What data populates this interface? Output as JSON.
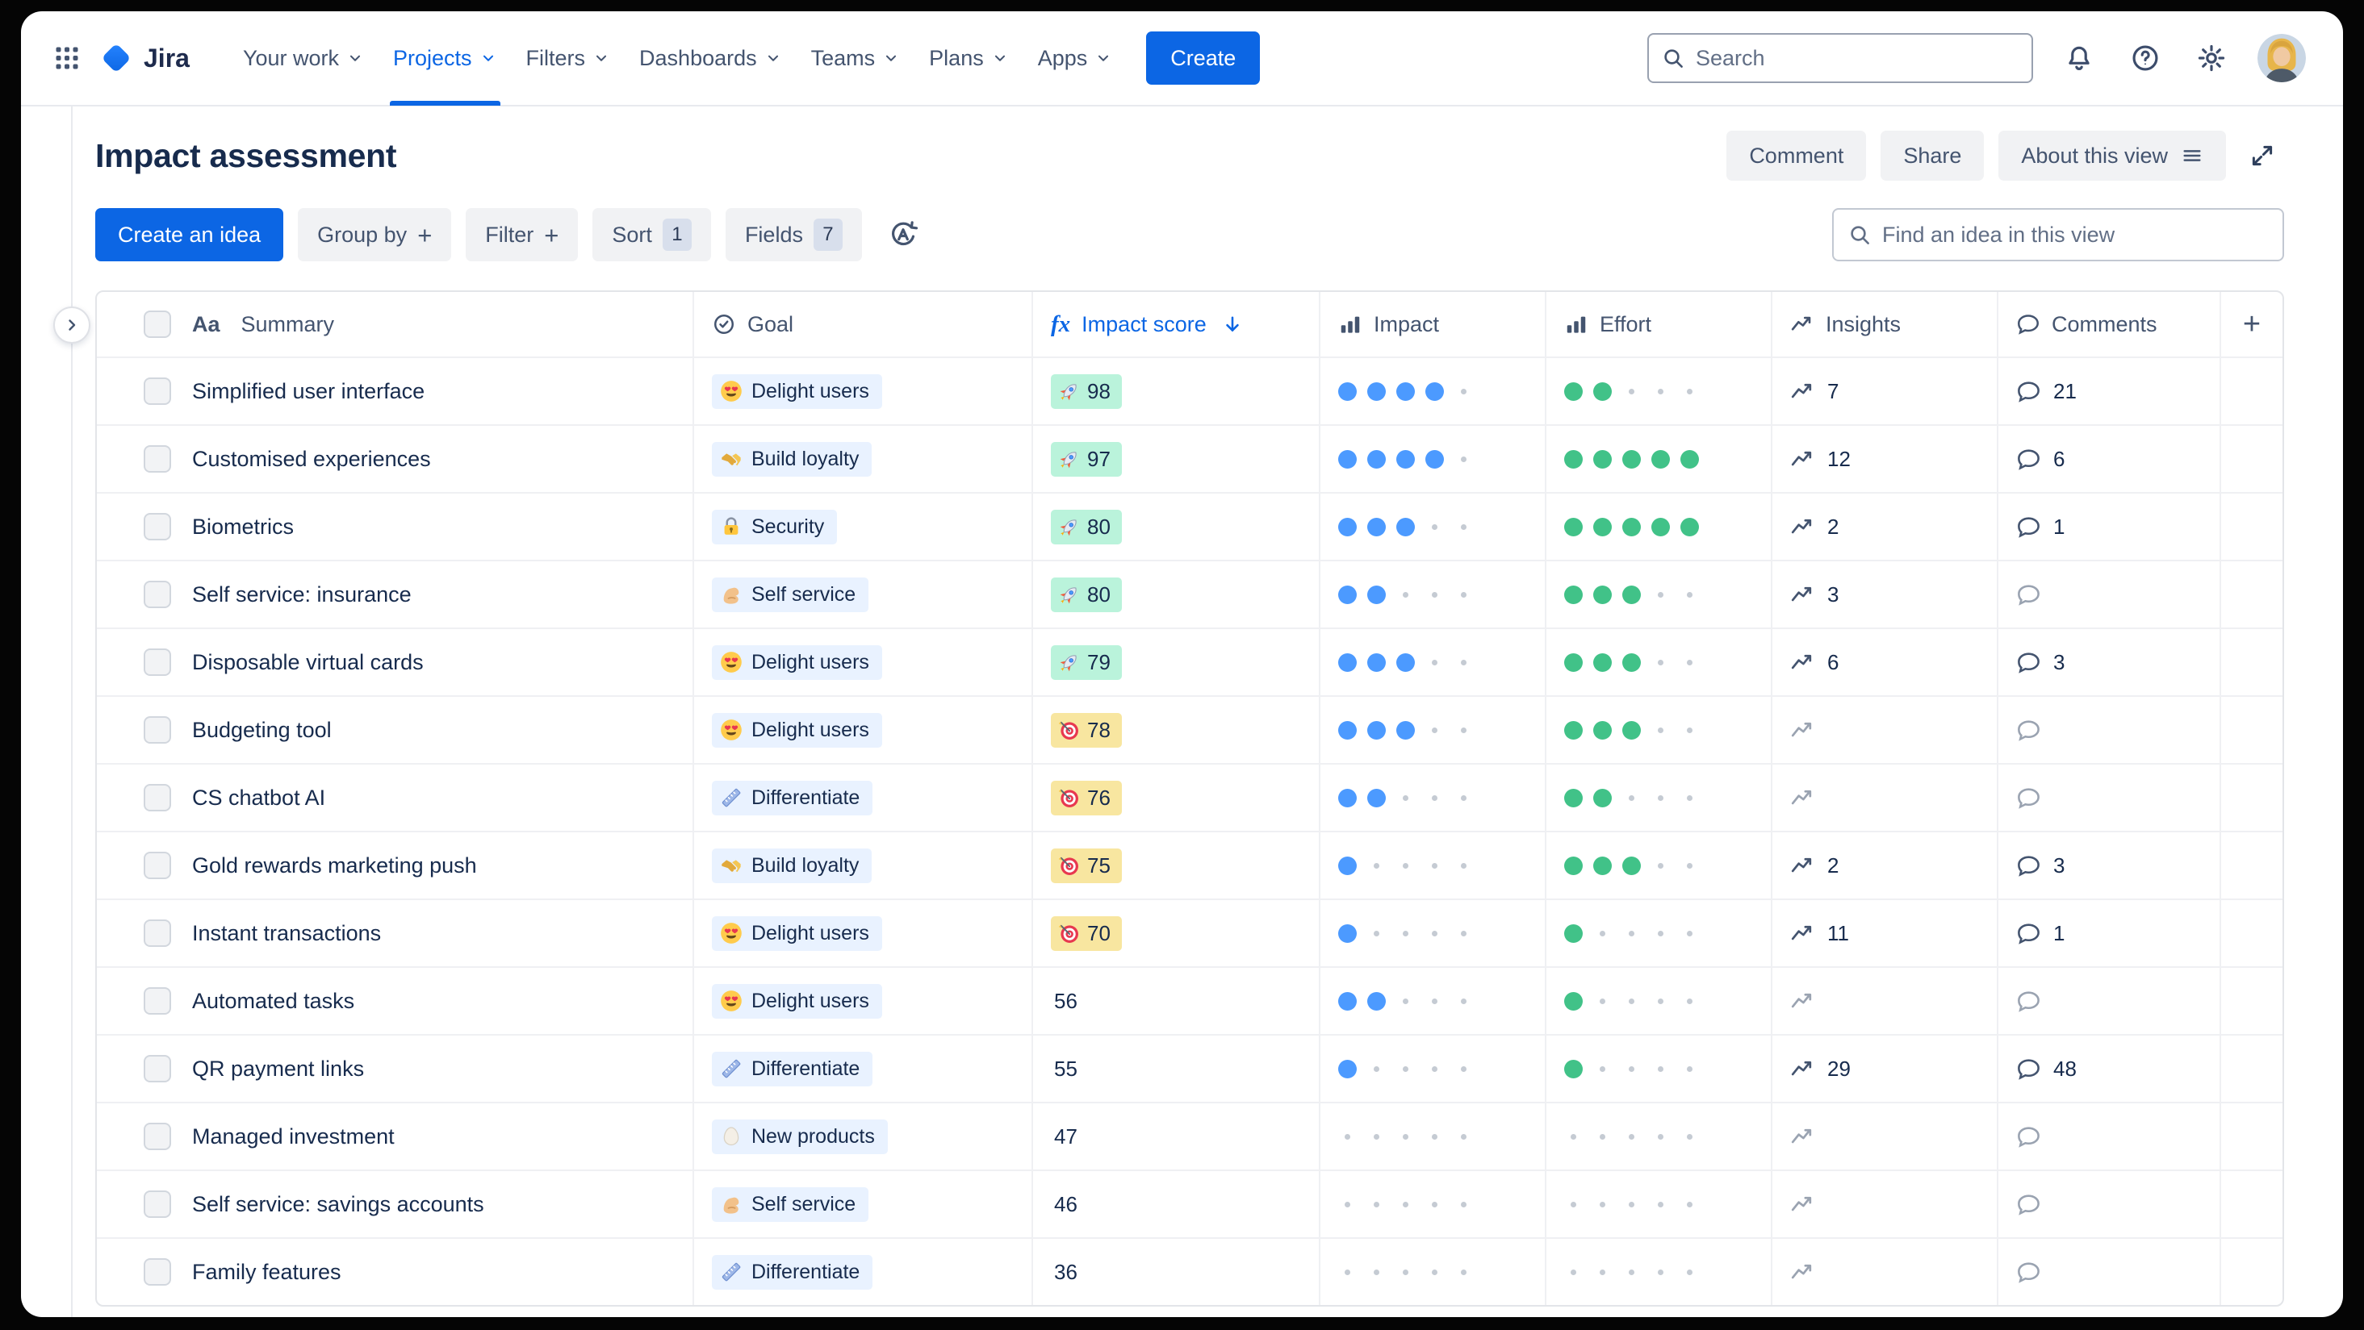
{
  "colors": {
    "accent_blue": "#0C66E4",
    "goal_badge_bg": "#E9F2FF",
    "score_green_bg": "#BAF3DB",
    "score_yellow_bg": "#F8E6A0",
    "impact_dot": "#4C9AFF",
    "effort_dot": "#41C288"
  },
  "nav": {
    "logo_text": "Jira",
    "items": [
      {
        "label": "Your work"
      },
      {
        "label": "Projects",
        "active": true
      },
      {
        "label": "Filters"
      },
      {
        "label": "Dashboards"
      },
      {
        "label": "Teams"
      },
      {
        "label": "Plans"
      },
      {
        "label": "Apps"
      }
    ],
    "create_label": "Create",
    "search_placeholder": "Search",
    "right_icons": [
      "notifications-icon",
      "help-icon",
      "settings-icon",
      "user-avatar"
    ]
  },
  "header": {
    "title": "Impact assessment",
    "comment_label": "Comment",
    "share_label": "Share",
    "about_label": "About this view"
  },
  "toolbar": {
    "create_idea_label": "Create an idea",
    "chips": [
      {
        "label": "Group by",
        "suffix": "+"
      },
      {
        "label": "Filter",
        "suffix": "+"
      },
      {
        "label": "Sort",
        "count": "1"
      },
      {
        "label": "Fields",
        "count": "7"
      }
    ],
    "auto_sort_icon": "auto-sort-icon",
    "find_placeholder": "Find an idea in this view"
  },
  "table": {
    "summary_type_glyph": "Aa",
    "formula_glyph": "fx",
    "columns": {
      "summary": "Summary",
      "goal": "Goal",
      "impact_score": "Impact score",
      "impact": "Impact",
      "effort": "Effort",
      "insights": "Insights",
      "comments": "Comments",
      "add_column": "+"
    },
    "sort": {
      "column": "Impact score",
      "direction": "desc"
    },
    "rating_max": 5,
    "rows": [
      {
        "summary": "Simplified user interface",
        "goal": {
          "icon": "heart-eyes-emoji",
          "label": "Delight users"
        },
        "score": {
          "value": 98,
          "tier": "green",
          "icon": "rocket-emoji"
        },
        "impact": 4,
        "effort": 2,
        "insights": 7,
        "comments": 21
      },
      {
        "summary": "Customised experiences",
        "goal": {
          "icon": "handshake-emoji",
          "label": "Build loyalty"
        },
        "score": {
          "value": 97,
          "tier": "green",
          "icon": "rocket-emoji"
        },
        "impact": 4,
        "effort": 5,
        "insights": 12,
        "comments": 6
      },
      {
        "summary": "Biometrics",
        "goal": {
          "icon": "locked-with-key-emoji",
          "label": "Security"
        },
        "score": {
          "value": 80,
          "tier": "green",
          "icon": "rocket-emoji"
        },
        "impact": 3,
        "effort": 5,
        "insights": 2,
        "comments": 1
      },
      {
        "summary": "Self service: insurance",
        "goal": {
          "icon": "flexed-biceps-emoji",
          "label": "Self service"
        },
        "score": {
          "value": 80,
          "tier": "green",
          "icon": "rocket-emoji"
        },
        "impact": 2,
        "effort": 3,
        "insights": 3,
        "comments": null
      },
      {
        "summary": "Disposable virtual cards",
        "goal": {
          "icon": "heart-eyes-emoji",
          "label": "Delight users"
        },
        "score": {
          "value": 79,
          "tier": "green",
          "icon": "rocket-emoji"
        },
        "impact": 3,
        "effort": 3,
        "insights": 6,
        "comments": 3
      },
      {
        "summary": "Budgeting tool",
        "goal": {
          "icon": "heart-eyes-emoji",
          "label": "Delight users"
        },
        "score": {
          "value": 78,
          "tier": "yellow",
          "icon": "direct-hit-emoji"
        },
        "impact": 3,
        "effort": 3,
        "insights": null,
        "comments": null
      },
      {
        "summary": "CS chatbot AI",
        "goal": {
          "icon": "ruler-emoji",
          "label": "Differentiate"
        },
        "score": {
          "value": 76,
          "tier": "yellow",
          "icon": "direct-hit-emoji"
        },
        "impact": 2,
        "effort": 2,
        "insights": null,
        "comments": null
      },
      {
        "summary": "Gold rewards marketing push",
        "goal": {
          "icon": "handshake-emoji",
          "label": "Build loyalty"
        },
        "score": {
          "value": 75,
          "tier": "yellow",
          "icon": "direct-hit-emoji"
        },
        "impact": 1,
        "effort": 3,
        "insights": 2,
        "comments": 3
      },
      {
        "summary": "Instant transactions",
        "goal": {
          "icon": "heart-eyes-emoji",
          "label": "Delight users"
        },
        "score": {
          "value": 70,
          "tier": "yellow",
          "icon": "direct-hit-emoji"
        },
        "impact": 1,
        "effort": 1,
        "insights": 11,
        "comments": 1
      },
      {
        "summary": "Automated tasks",
        "goal": {
          "icon": "heart-eyes-emoji",
          "label": "Delight users"
        },
        "score": {
          "value": 56,
          "tier": "none",
          "icon": null
        },
        "impact": 2,
        "effort": 1,
        "insights": null,
        "comments": null
      },
      {
        "summary": "QR payment links",
        "goal": {
          "icon": "ruler-emoji",
          "label": "Differentiate"
        },
        "score": {
          "value": 55,
          "tier": "none",
          "icon": null
        },
        "impact": 1,
        "effort": 1,
        "insights": 29,
        "comments": 48
      },
      {
        "summary": "Managed investment",
        "goal": {
          "icon": "egg-emoji",
          "label": "New products"
        },
        "score": {
          "value": 47,
          "tier": "none",
          "icon": null
        },
        "impact": 0,
        "effort": 0,
        "insights": null,
        "comments": null
      },
      {
        "summary": "Self service: savings accounts",
        "goal": {
          "icon": "flexed-biceps-emoji",
          "label": "Self service"
        },
        "score": {
          "value": 46,
          "tier": "none",
          "icon": null
        },
        "impact": 0,
        "effort": 0,
        "insights": null,
        "comments": null
      },
      {
        "summary": "Family features",
        "goal": {
          "icon": "ruler-emoji",
          "label": "Differentiate"
        },
        "score": {
          "value": 36,
          "tier": "none",
          "icon": null
        },
        "impact": 0,
        "effort": 0,
        "insights": null,
        "comments": null
      }
    ]
  }
}
